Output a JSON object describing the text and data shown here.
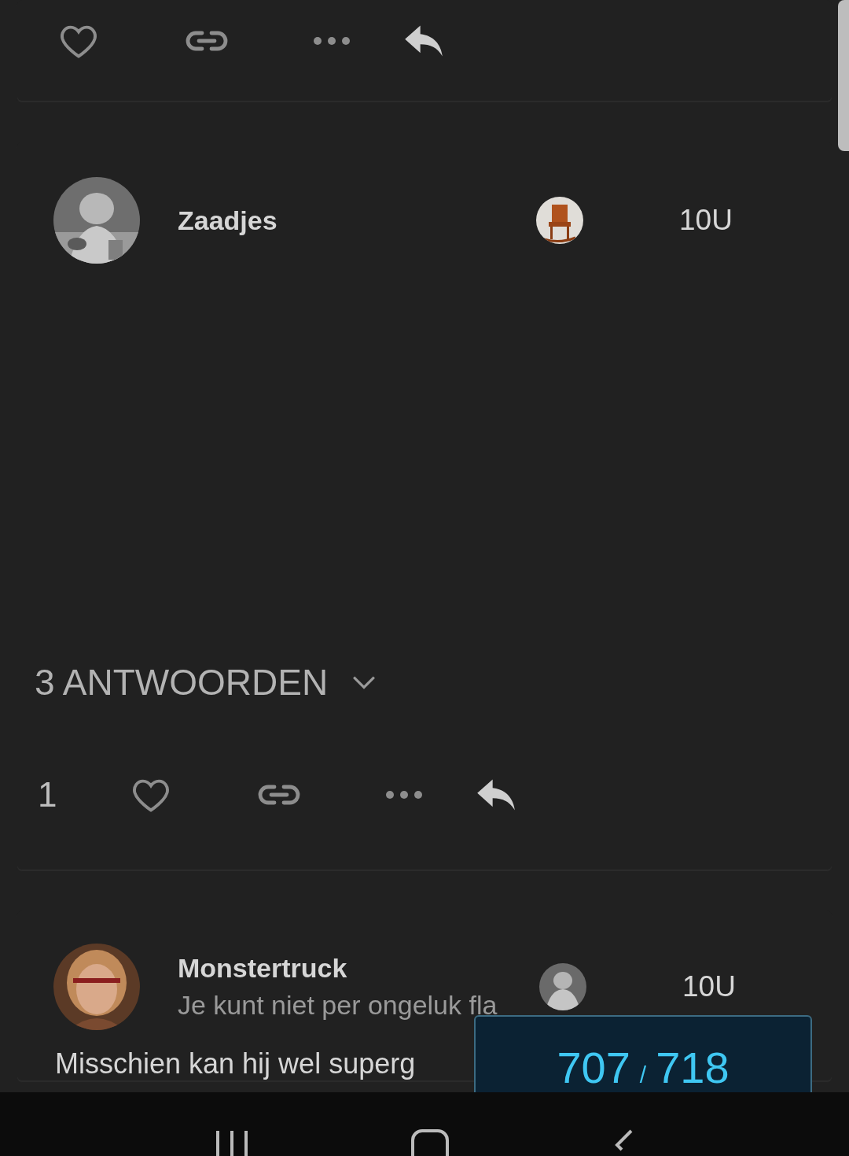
{
  "posts": [
    {
      "author": "Zaadjes",
      "time": "10U",
      "replies_label": "3 ANTWOORDEN",
      "like_count": "1"
    },
    {
      "author": "Monstertruck",
      "excerpt": "Je kunt niet per ongeluk fla",
      "time": "10U",
      "body": "Misschien kan hij wel superg"
    }
  ],
  "progress": {
    "current": "707",
    "separator": "/",
    "total": "718"
  }
}
